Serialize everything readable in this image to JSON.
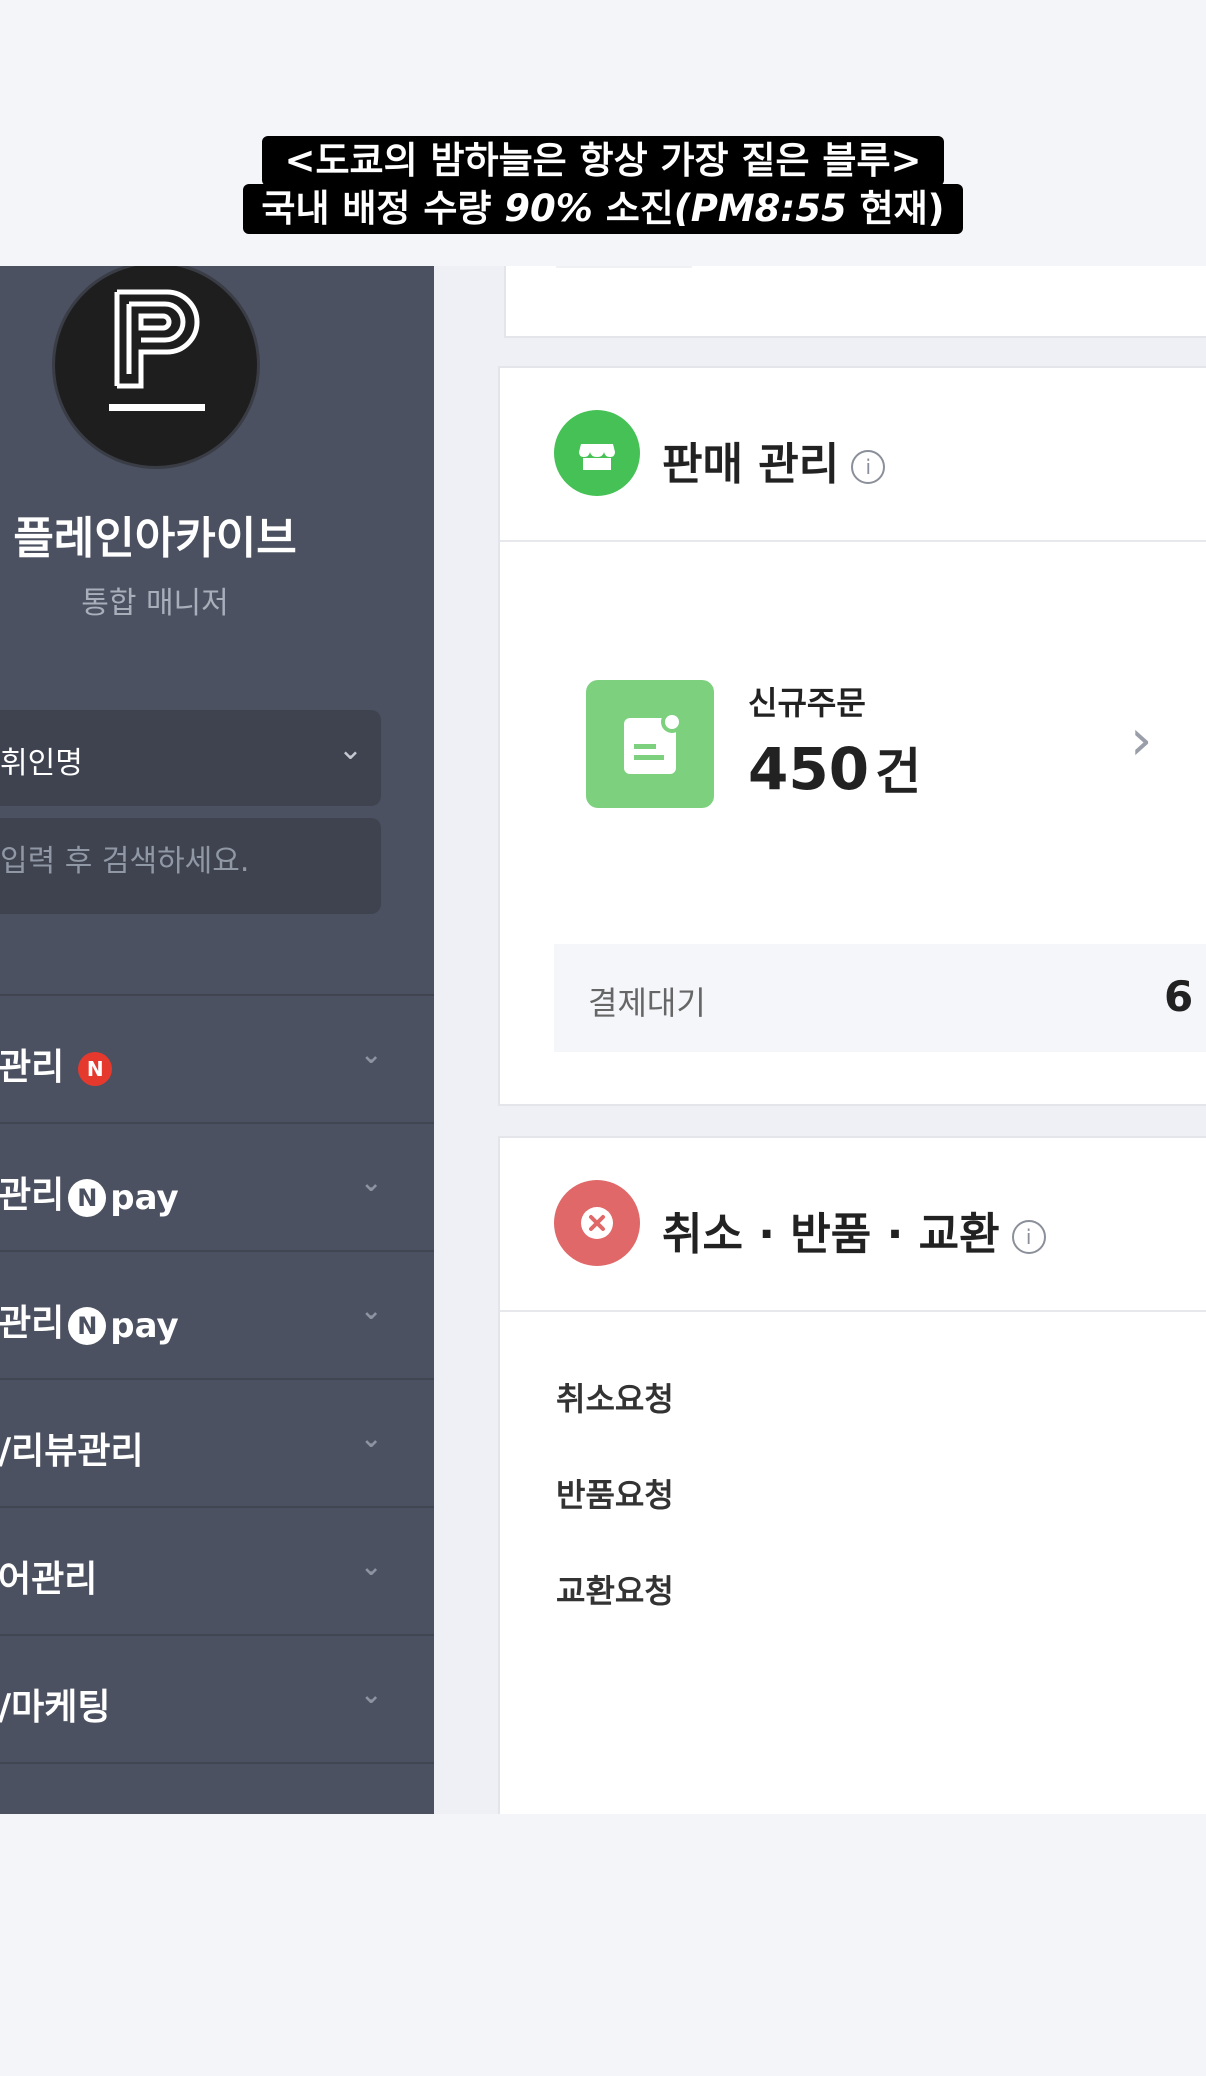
{
  "caption": {
    "line1": "<도쿄의 밤하늘은 항상 가장 짙은 블루>",
    "line2_prefix": "국내 배정 수량 ",
    "line2_em1": "90%",
    "line2_mid": " 소진",
    "line2_em2": "(PM8:55",
    "line2_suffix": " 현재)"
  },
  "sidebar": {
    "store_name": "플레인아카이브",
    "store_role": "통합 매니저",
    "select_value": "휘인명",
    "search_placeholder": "입력 후 검색하세요.",
    "menu": [
      {
        "label": "관리",
        "badge": "N"
      },
      {
        "label": "관리",
        "npay_n": "N",
        "npay_text": "pay"
      },
      {
        "label": "관리",
        "npay_n": "N",
        "npay_text": "pay"
      },
      {
        "label": "/리뷰관리"
      },
      {
        "label": "어관리"
      },
      {
        "label": "/마케팅"
      }
    ]
  },
  "sales_card": {
    "title": "판매 관리",
    "info": "i",
    "new_order_label": "신규주문",
    "new_order_count": "450",
    "new_order_unit": "건",
    "pending_label": "결제대기",
    "pending_value": "6"
  },
  "cancel_card": {
    "title": "취소 · 반품 · 교환",
    "info": "i",
    "rows": [
      "취소요청",
      "반품요청",
      "교환요청"
    ]
  },
  "colors": {
    "sidebar_bg": "#4b5160",
    "sales_icon": "#46c156",
    "order_icon": "#7dd07d",
    "cancel_icon": "#e06868",
    "badge_red": "#e5392e"
  },
  "icons": {
    "logo": "p-logo-icon",
    "sales": "store-icon",
    "order": "document-icon",
    "cancel": "x-circle-icon",
    "chevron": "chevron-down-icon",
    "arrow": "chevron-right-icon"
  }
}
